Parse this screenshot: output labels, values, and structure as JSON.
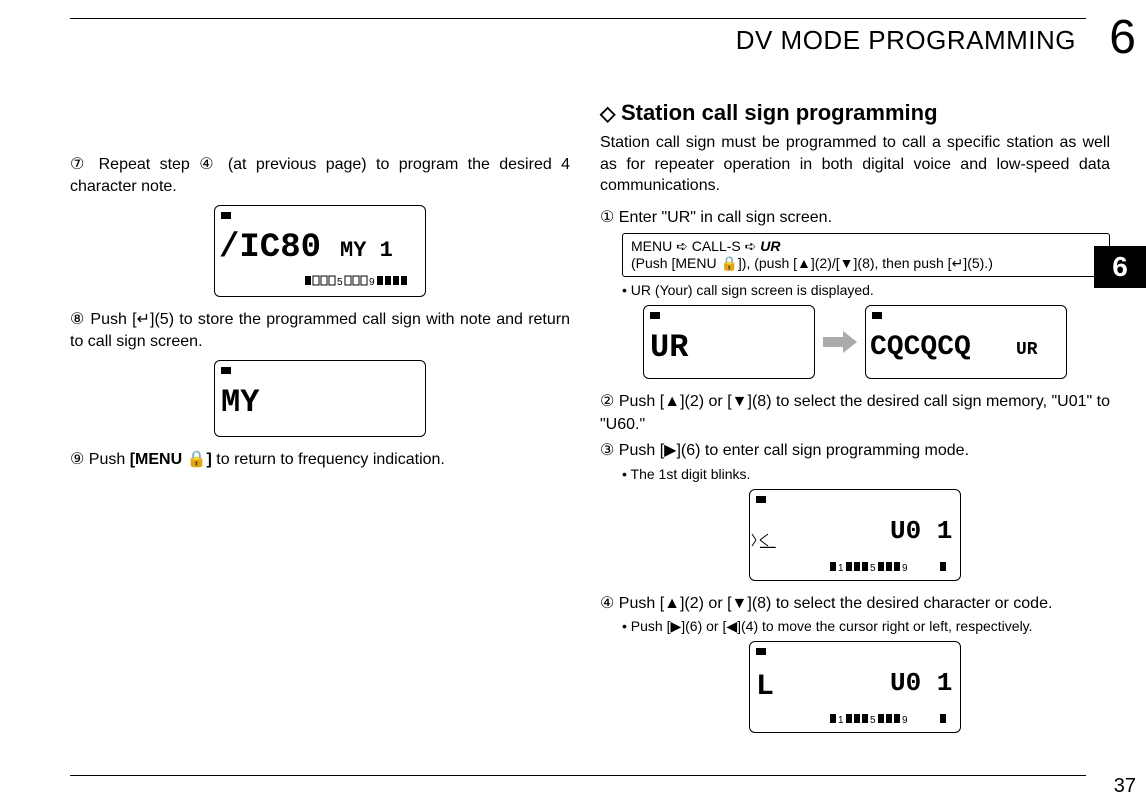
{
  "header": {
    "chapter_title": "DV MODE PROGRAMMING",
    "chapter_number": "6",
    "side_tab": "6"
  },
  "footer": {
    "page_number": "37"
  },
  "left_column": {
    "step7": "⑦ Repeat step ④ (at previous page) to program the desired 4 character note.",
    "lcd1_text": "IC80   MY1",
    "step8": "⑧ Push [↵](5) to store the programmed call sign with note and return to call sign screen.",
    "lcd2_text": "MY",
    "step9_pre": "⑨ Push ",
    "step9_button": "[MENU 🔒]",
    "step9_post": " to return to frequency indication."
  },
  "right_column": {
    "section_title": "Station call sign programming",
    "intro": "Station call sign must be programmed to call a specific station as well as for repeater operation in both digital voice and low-speed data communications.",
    "step1": "① Enter \"UR\" in call sign screen.",
    "menu_line1_a": " MENU ➪ CALL-S ➪ ",
    "menu_line1_b": "UR",
    "menu_line2": "(Push [MENU 🔒]), (push [▲](2)/[▼](8), then push [↵](5).)",
    "step1_note": "• UR (Your) call sign screen is displayed.",
    "lcd_ur_a": "UR",
    "lcd_ur_b": "CQCQCQ UR",
    "step2": "② Push [▲](2) or [▼](8) to select the desired call sign memory, \"U01\" to \"U60.\"",
    "step3": "③ Push [▶](6) to enter call sign programming mode.",
    "step3_note": "• The 1st digit blinks.",
    "lcd_u01": "U01",
    "step4": "④ Push [▲](2) or [▼](8) to select the desired character or code.",
    "step4_note": "• Push [▶](6) or [◀](4) to move the cursor right or left, respectively."
  }
}
